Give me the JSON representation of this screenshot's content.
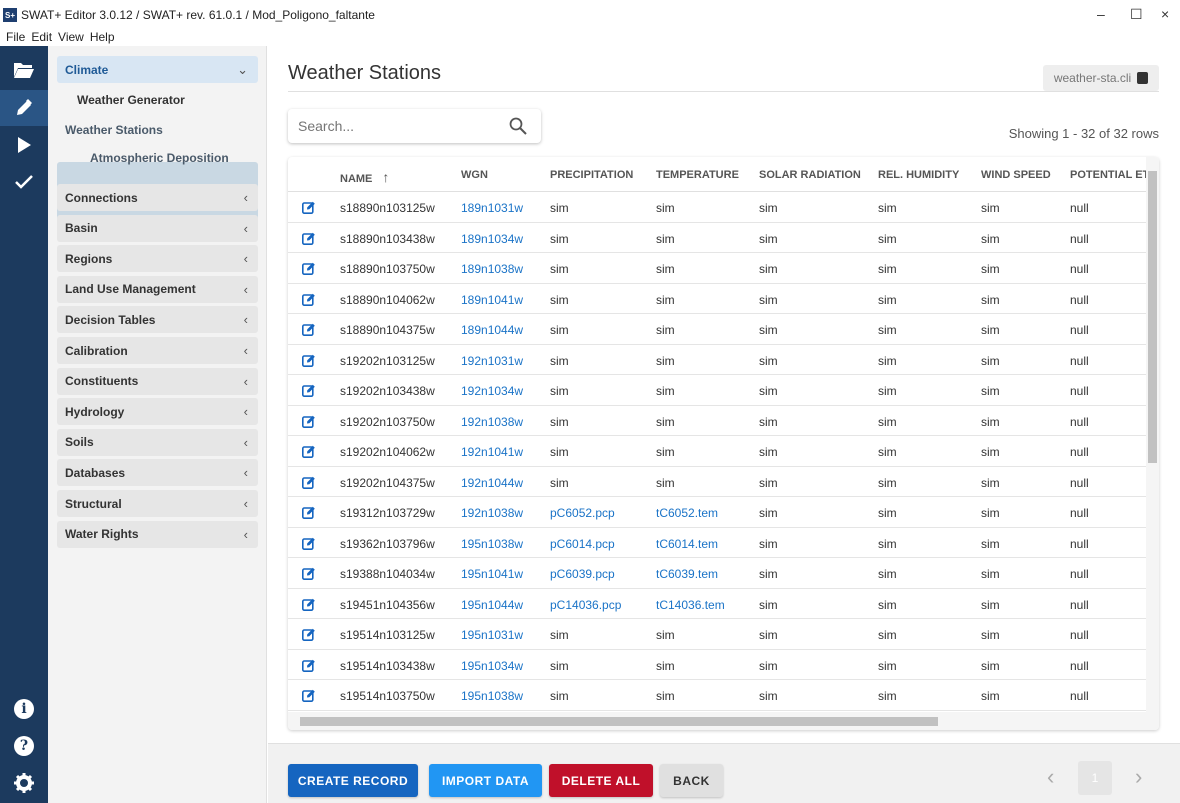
{
  "window": {
    "title": "SWAT+ Editor 3.0.12 / SWAT+ rev. 61.0.1 / Mod_Poligono_faltante",
    "app_icon": "S+",
    "controls": [
      "–",
      "☐",
      "×"
    ]
  },
  "menu": [
    "File",
    "Edit",
    "View",
    "Help"
  ],
  "nav": {
    "climate": "Climate",
    "sub": [
      "Weather Generator",
      "Weather Stations",
      "Atmospheric Deposition"
    ],
    "sections": [
      "Connections",
      "Basin",
      "Regions",
      "Land Use Management",
      "Decision Tables",
      "Calibration",
      "Constituents",
      "Hydrology",
      "Soils",
      "Databases",
      "Structural",
      "Water Rights"
    ]
  },
  "page": {
    "title": "Weather Stations",
    "file": "weather-sta.cli",
    "search_placeholder": "Search...",
    "rows_info": "Showing 1 - 32 of 32 rows"
  },
  "table": {
    "columns": [
      "NAME",
      "WGN",
      "PRECIPITATION",
      "TEMPERATURE",
      "SOLAR RADIATION",
      "REL. HUMIDITY",
      "WIND SPEED",
      "POTENTIAL ET"
    ],
    "sort_indicator": "↑",
    "rows": [
      [
        "s18890n103125w",
        "189n1031w",
        "sim",
        "sim",
        "sim",
        "sim",
        "sim",
        "null"
      ],
      [
        "s18890n103438w",
        "189n1034w",
        "sim",
        "sim",
        "sim",
        "sim",
        "sim",
        "null"
      ],
      [
        "s18890n103750w",
        "189n1038w",
        "sim",
        "sim",
        "sim",
        "sim",
        "sim",
        "null"
      ],
      [
        "s18890n104062w",
        "189n1041w",
        "sim",
        "sim",
        "sim",
        "sim",
        "sim",
        "null"
      ],
      [
        "s18890n104375w",
        "189n1044w",
        "sim",
        "sim",
        "sim",
        "sim",
        "sim",
        "null"
      ],
      [
        "s19202n103125w",
        "192n1031w",
        "sim",
        "sim",
        "sim",
        "sim",
        "sim",
        "null"
      ],
      [
        "s19202n103438w",
        "192n1034w",
        "sim",
        "sim",
        "sim",
        "sim",
        "sim",
        "null"
      ],
      [
        "s19202n103750w",
        "192n1038w",
        "sim",
        "sim",
        "sim",
        "sim",
        "sim",
        "null"
      ],
      [
        "s19202n104062w",
        "192n1041w",
        "sim",
        "sim",
        "sim",
        "sim",
        "sim",
        "null"
      ],
      [
        "s19202n104375w",
        "192n1044w",
        "sim",
        "sim",
        "sim",
        "sim",
        "sim",
        "null"
      ],
      [
        "s19312n103729w",
        "192n1038w",
        "pC6052.pcp",
        "tC6052.tem",
        "sim",
        "sim",
        "sim",
        "null"
      ],
      [
        "s19362n103796w",
        "195n1038w",
        "pC6014.pcp",
        "tC6014.tem",
        "sim",
        "sim",
        "sim",
        "null"
      ],
      [
        "s19388n104034w",
        "195n1041w",
        "pC6039.pcp",
        "tC6039.tem",
        "sim",
        "sim",
        "sim",
        "null"
      ],
      [
        "s19451n104356w",
        "195n1044w",
        "pC14036.pcp",
        "tC14036.tem",
        "sim",
        "sim",
        "sim",
        "null"
      ],
      [
        "s19514n103125w",
        "195n1031w",
        "sim",
        "sim",
        "sim",
        "sim",
        "sim",
        "null"
      ],
      [
        "s19514n103438w",
        "195n1034w",
        "sim",
        "sim",
        "sim",
        "sim",
        "sim",
        "null"
      ],
      [
        "s19514n103750w",
        "195n1038w",
        "sim",
        "sim",
        "sim",
        "sim",
        "sim",
        "null"
      ]
    ]
  },
  "buttons": {
    "create": "CREATE RECORD",
    "import": "IMPORT DATA",
    "delete": "DELETE ALL",
    "back": "BACK"
  },
  "pager": {
    "prev": "‹",
    "page": "1",
    "next": "›"
  },
  "colors": {
    "rail": "#1c3a5e",
    "primary": "#1565c0",
    "import": "#2196f3",
    "danger": "#c0102a",
    "link": "#1a73c7"
  }
}
